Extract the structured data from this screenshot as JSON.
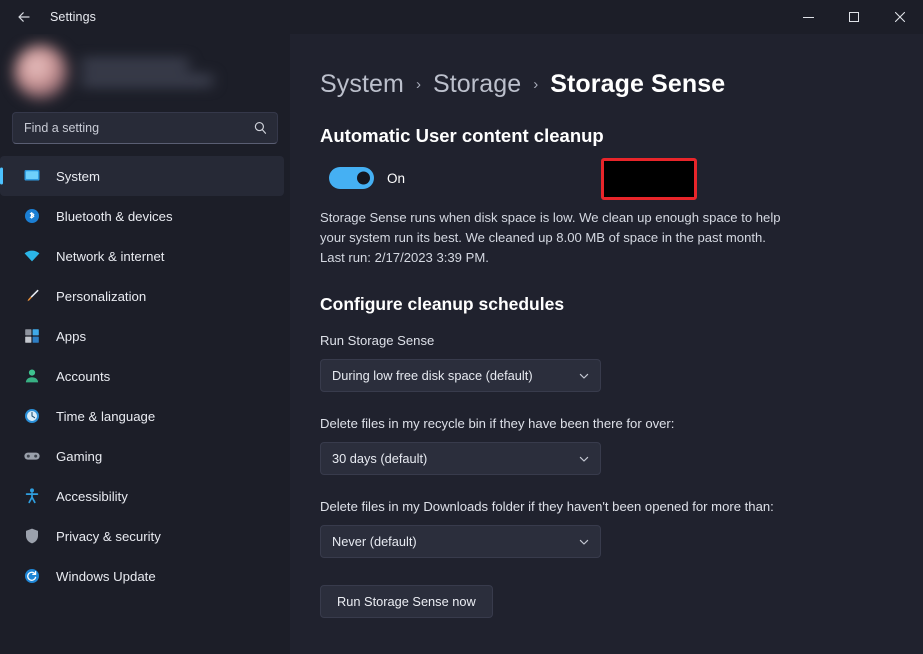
{
  "titlebar": {
    "back_icon": "back-arrow-icon",
    "app_title": "Settings",
    "minimize_label": "Minimize",
    "maximize_label": "Maximize",
    "close_label": "Close"
  },
  "sidebar": {
    "profile": {
      "avatar": "user-avatar",
      "name_redacted": "",
      "email_redacted": ""
    },
    "search": {
      "placeholder": "Find a setting",
      "value": "",
      "icon": "search-icon"
    },
    "items": [
      {
        "label": "System",
        "icon": "monitor-icon",
        "selected": true
      },
      {
        "label": "Bluetooth & devices",
        "icon": "bluetooth-icon",
        "selected": false
      },
      {
        "label": "Network & internet",
        "icon": "wifi-icon",
        "selected": false
      },
      {
        "label": "Personalization",
        "icon": "paintbrush-icon",
        "selected": false
      },
      {
        "label": "Apps",
        "icon": "apps-grid-icon",
        "selected": false
      },
      {
        "label": "Accounts",
        "icon": "person-icon",
        "selected": false
      },
      {
        "label": "Time & language",
        "icon": "clock-icon",
        "selected": false
      },
      {
        "label": "Gaming",
        "icon": "gamepad-icon",
        "selected": false
      },
      {
        "label": "Accessibility",
        "icon": "accessibility-icon",
        "selected": false
      },
      {
        "label": "Privacy & security",
        "icon": "shield-icon",
        "selected": false
      },
      {
        "label": "Windows Update",
        "icon": "update-refresh-icon",
        "selected": false
      }
    ]
  },
  "main": {
    "breadcrumb": {
      "root": "System",
      "parent": "Storage",
      "current": "Storage Sense",
      "separator": "›"
    },
    "section_title": "Automatic User content cleanup",
    "toggle": {
      "state_label": "On",
      "enabled": true
    },
    "description": "Storage Sense runs when disk space is low. We clean up enough space to help your system run its best. We cleaned up 8.00 MB of space in the past month. Last run: 2/17/2023 3:39 PM.",
    "configure_title": "Configure cleanup schedules",
    "fields": [
      {
        "label": "Run Storage Sense",
        "value": "During low free disk space (default)"
      },
      {
        "label": "Delete files in my recycle bin if they have been there for over:",
        "value": "30 days (default)"
      },
      {
        "label": "Delete files in my Downloads folder if they haven't been opened for more than:",
        "value": "Never (default)"
      }
    ],
    "run_button": "Run Storage Sense now"
  },
  "colors": {
    "accent": "#4cc2ff",
    "toggle_on": "#45b0f3",
    "annotation_red": "#e8252a",
    "background": "#20222e",
    "sidebar": "#1c1e28"
  }
}
